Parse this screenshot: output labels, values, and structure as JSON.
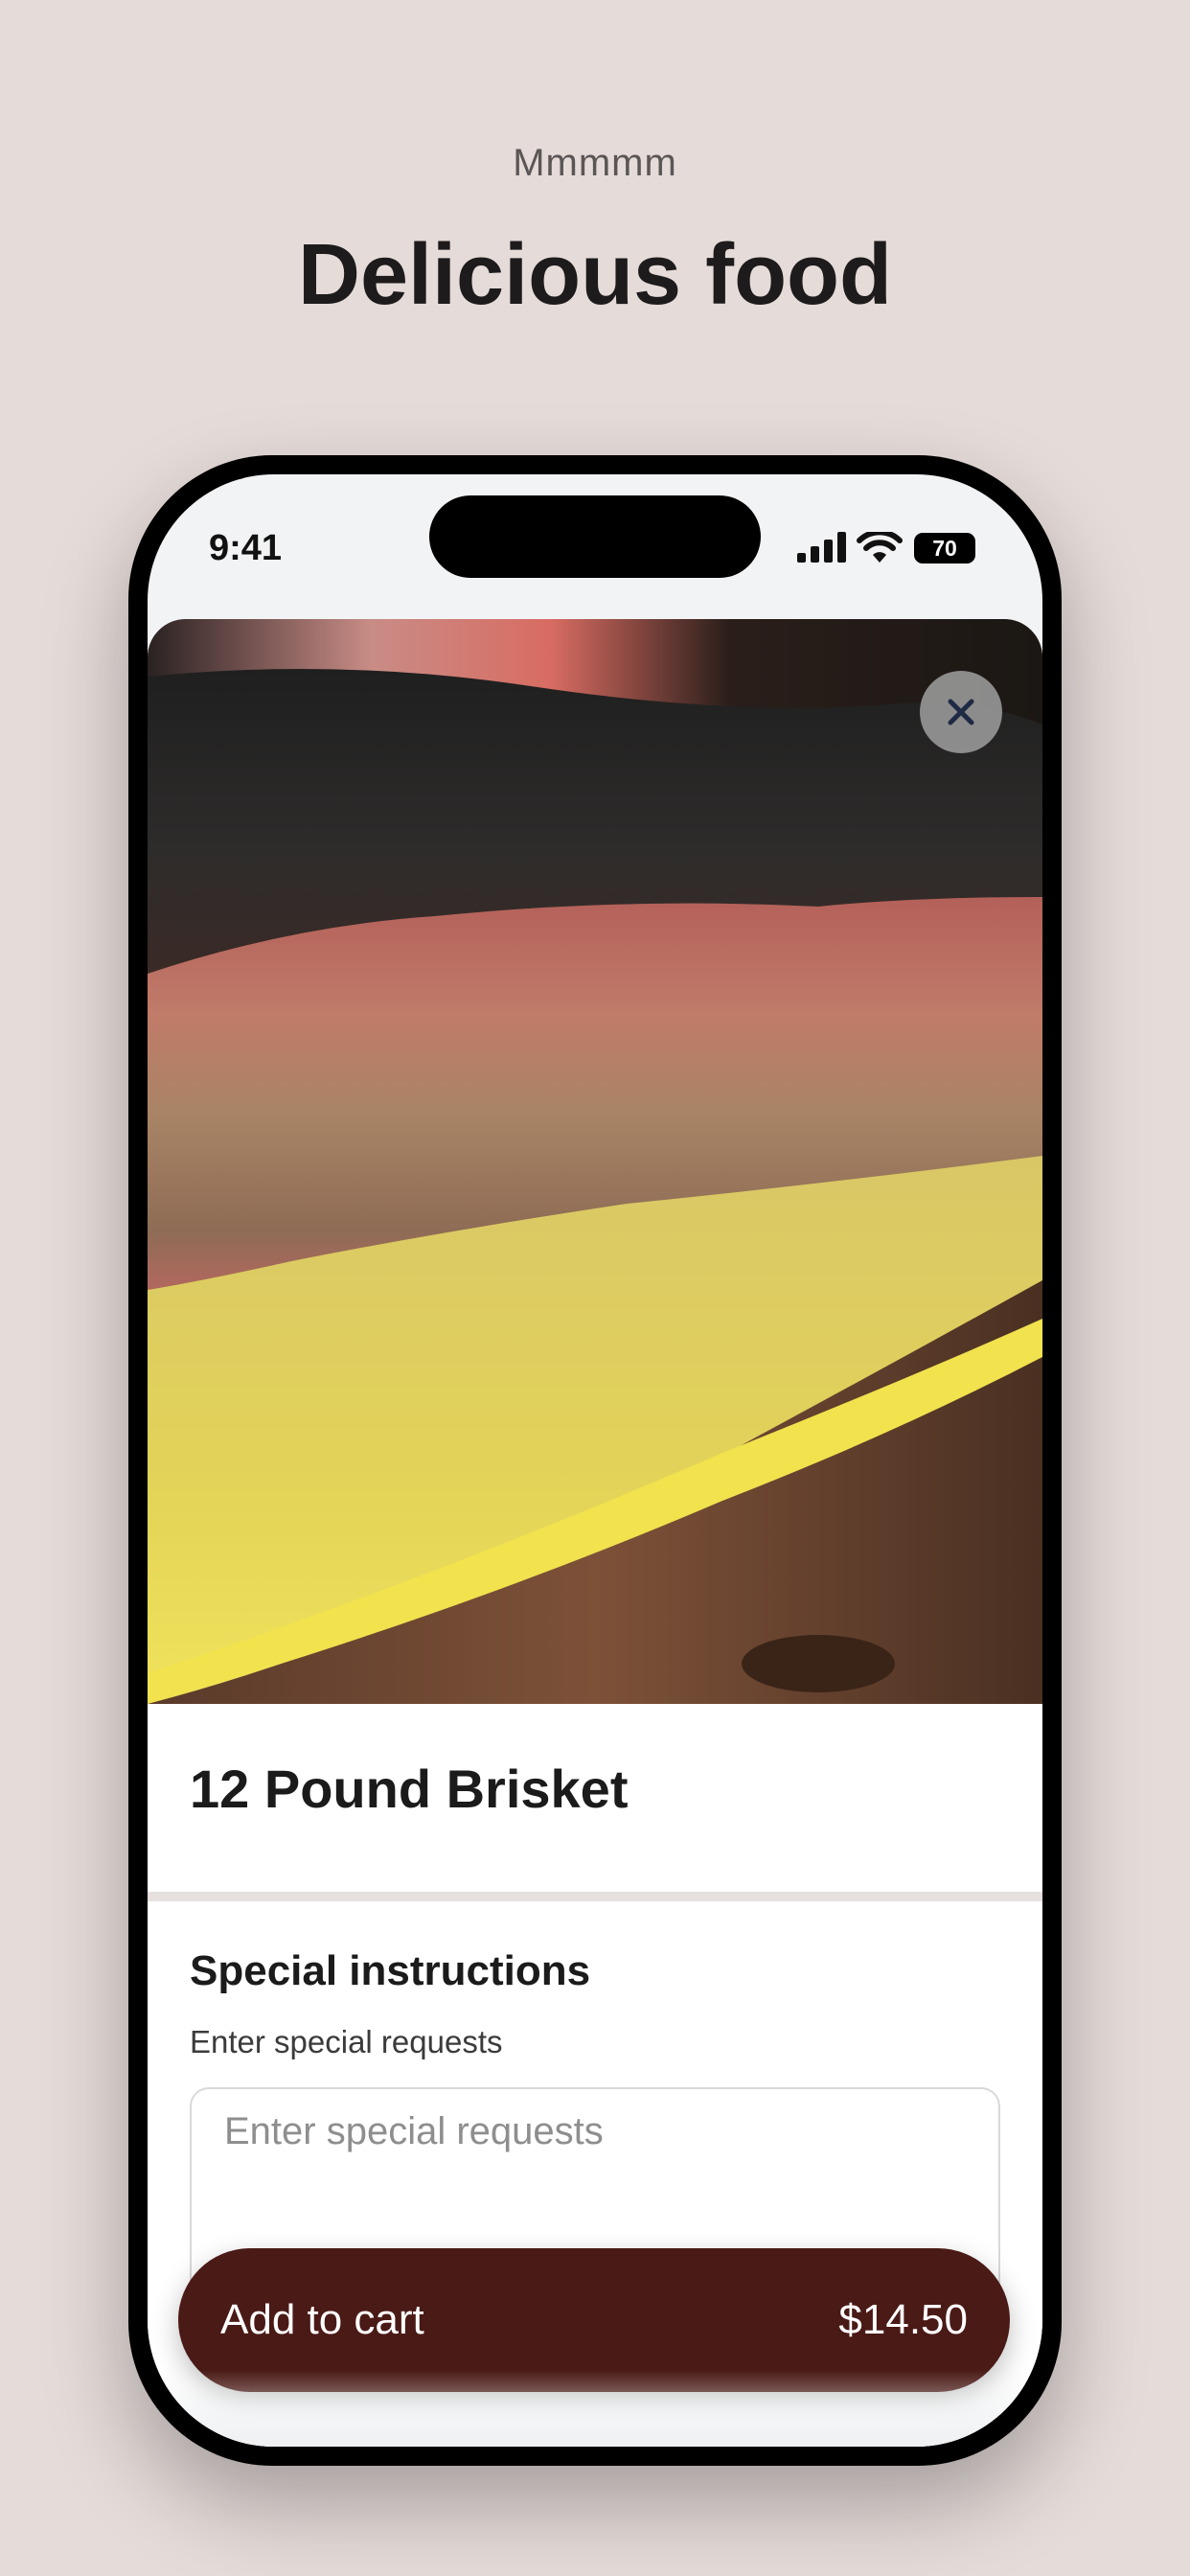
{
  "promo": {
    "kicker": "Mmmmm",
    "title": "Delicious food"
  },
  "status_bar": {
    "time": "9:41",
    "battery": "70"
  },
  "item": {
    "name": "12 Pound Brisket",
    "image_icon": "food-photo"
  },
  "instructions": {
    "title": "Special instructions",
    "subtitle": "Enter special requests",
    "placeholder": "Enter special requests"
  },
  "cart": {
    "label": "Add to cart",
    "price": "$14.50"
  },
  "colors": {
    "background": "#e5dbd9",
    "cart_button": "#4a1a16",
    "divider": "#e6e0de"
  }
}
